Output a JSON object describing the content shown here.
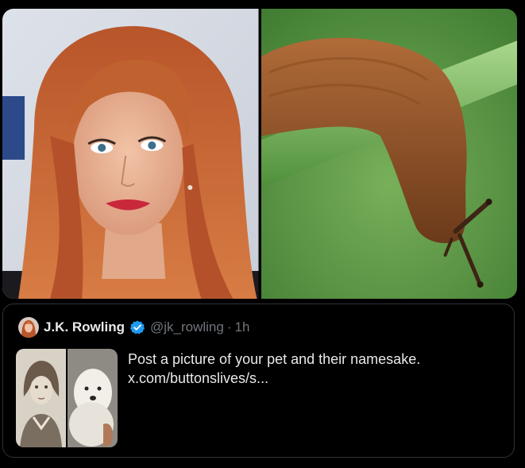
{
  "media": {
    "image_left": {
      "subject": "portrait photo of a red-haired woman"
    },
    "image_right": {
      "subject": "brown slug on a green stem"
    }
  },
  "quote": {
    "display_name": "J.K. Rowling",
    "handle": "@jk_rowling",
    "separator": "·",
    "time": "1h",
    "text": "Post a picture of your pet and their namesake.",
    "link_text": "x.com/buttonslives/s...",
    "verified_badge_color": "#1d9bf0"
  },
  "colors": {
    "background": "#000000",
    "text_primary": "#e7e9ea",
    "text_secondary": "#71767b",
    "border": "#2f3336"
  }
}
